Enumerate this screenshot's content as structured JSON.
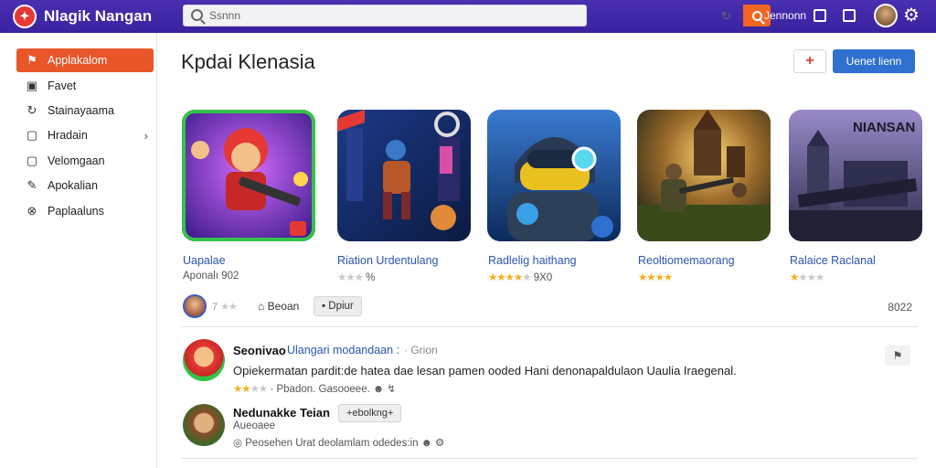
{
  "topbar": {
    "brand": "Nlagik Nangan",
    "search_placeholder": "Ssnnn",
    "user_label": "Jennonn",
    "accent": "#4a2fb0",
    "search_button_color": "#f26522"
  },
  "sidebar": {
    "items": [
      {
        "label": "Applakalom",
        "icon": "flag-icon",
        "active": true
      },
      {
        "label": "Favet",
        "icon": "square-icon"
      },
      {
        "label": "Stainayaama",
        "icon": "refresh-icon"
      },
      {
        "label": "Hradain",
        "icon": "square-icon",
        "chevron": "›"
      },
      {
        "label": "Velomgaan",
        "icon": "square-icon"
      },
      {
        "label": "Apokalian",
        "icon": "wrench-icon"
      },
      {
        "label": "Paplaaluns",
        "icon": "tag-icon"
      }
    ]
  },
  "main": {
    "title": "Kpdai Klenasia",
    "plus_button": "+",
    "primary_button": "Uenet lienn"
  },
  "apps": [
    {
      "name": "Uapalae",
      "sub": "Aponalı 902",
      "stars_on": 0,
      "stars_off": 0
    },
    {
      "name": "Riation Urdentulang",
      "sub": "%",
      "stars_on": 0,
      "stars_off": 3
    },
    {
      "name": "Radlelig haithang",
      "sub": "9X0",
      "stars_on": 4,
      "stars_off": 1
    },
    {
      "name": "Reoltiomemaorang",
      "sub": "",
      "stars_on": 4,
      "stars_off": 0
    },
    {
      "name": "Ralaice Raclanal",
      "sub": "",
      "stars_on": 1,
      "stars_off": 3
    }
  ],
  "tile5_text": "NIANSAN",
  "meta": {
    "stars": "7",
    "home_label": "Beoan",
    "chip_label": "Dpiur",
    "count": "8022"
  },
  "reviews": [
    {
      "name": "Seonivao",
      "link": "Ulangari modandaan :",
      "meta": "Grion",
      "text": "Opiekermatan pardit:de hatea dae lesan pamen ooded Hani denonapaldulaon Uaulia Iraegenal.",
      "footer": "Pbadon. Gasooeee.",
      "stars_on": 2,
      "stars_off": 2
    },
    {
      "name": "Nedunakke Teian",
      "chip": "+ebolkng+",
      "sub": "Aueoaee",
      "footer": "Peosehen Urat deolamlam odedes:in"
    }
  ]
}
